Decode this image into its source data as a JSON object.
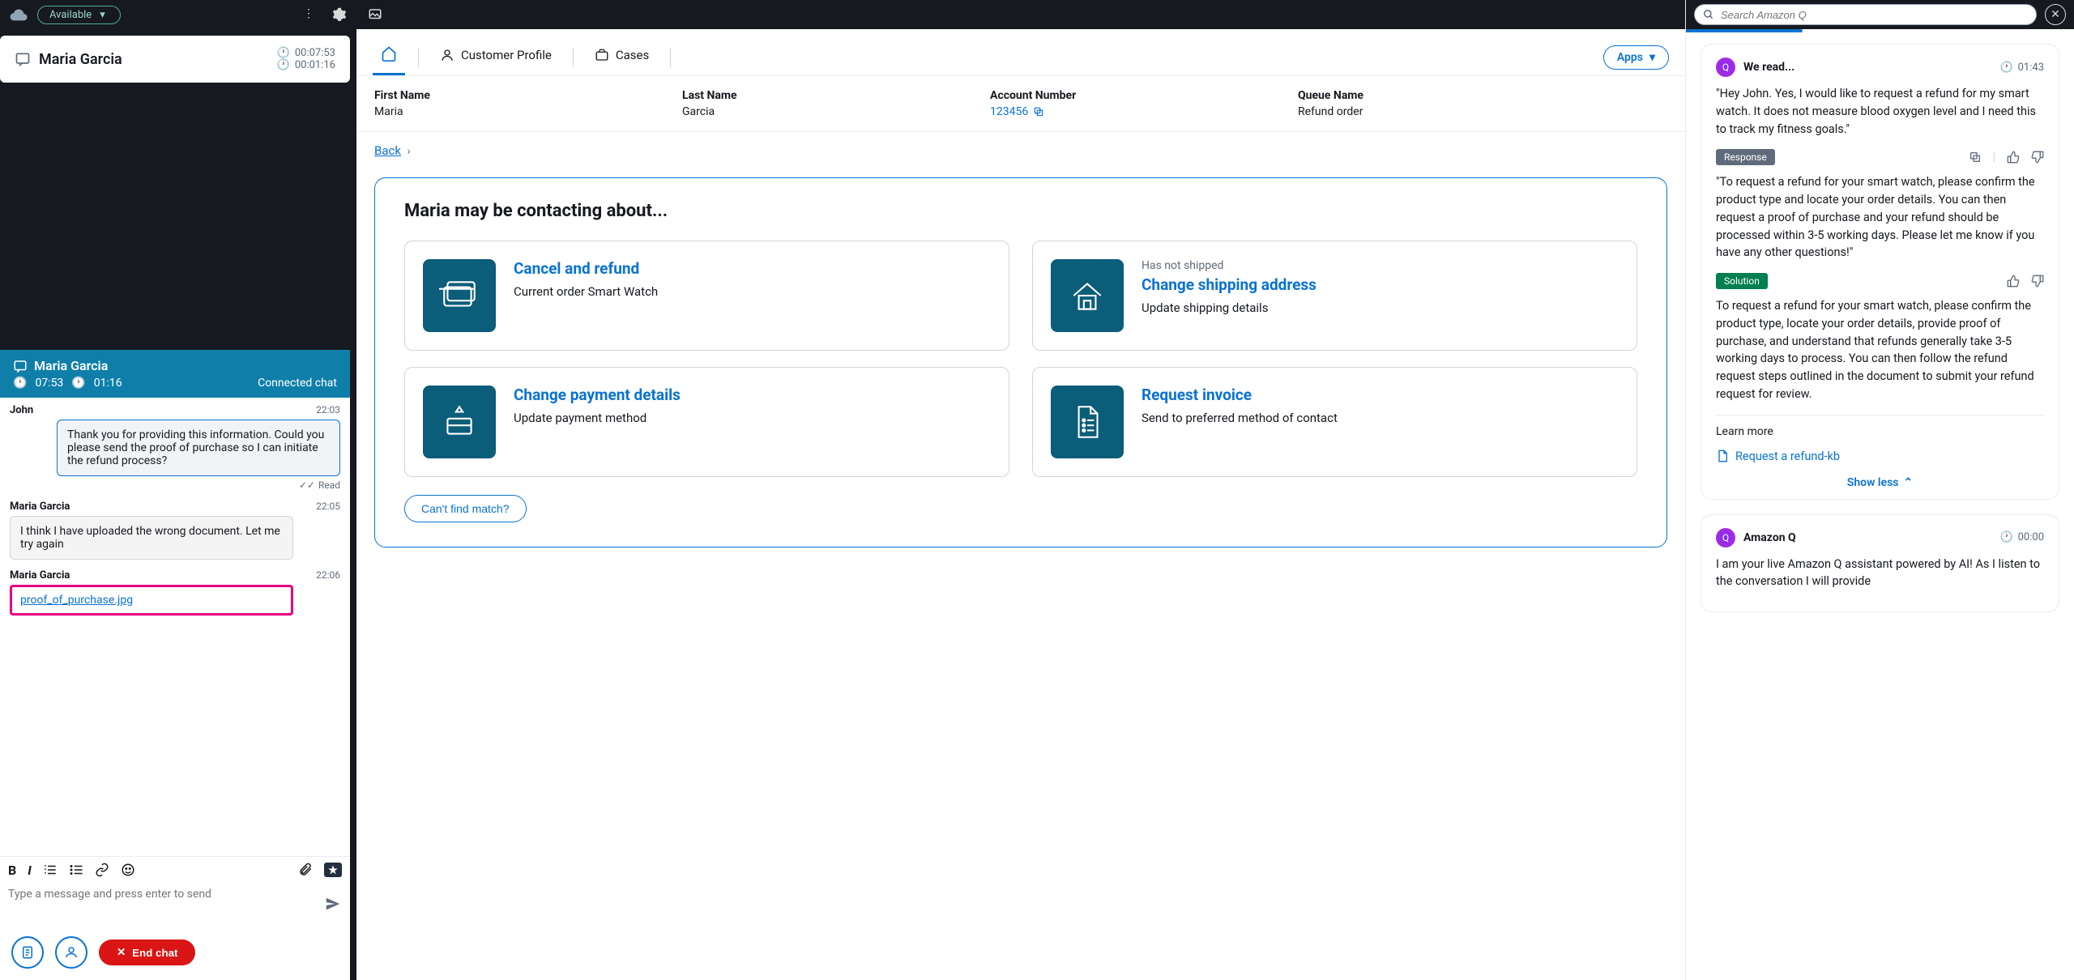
{
  "topbar": {
    "status": "Available",
    "contact_name": "Maria Garcia",
    "timer1": "00:07:53",
    "timer2": "00:01:16"
  },
  "active_contact": {
    "name": "Maria Garcia",
    "t1": "07:53",
    "t2": "01:16",
    "status": "Connected chat"
  },
  "chat": {
    "agent_name": "John",
    "agent_time": "22:03",
    "agent_msg": "Thank you for providing this information. Could you please send the proof of purchase so I can initiate the refund process?",
    "read": "Read",
    "cust1_name": "Maria Garcia",
    "cust1_time": "22:05",
    "cust1_msg": "I think I have uploaded the wrong document. Let me try again",
    "cust2_name": "Maria Garcia",
    "cust2_time": "22:06",
    "attachment": "proof_of_purchase.jpg",
    "placeholder": "Type a message and press enter to send",
    "end_chat": "End chat"
  },
  "nav": {
    "customer_profile": "Customer Profile",
    "cases": "Cases",
    "apps": "Apps"
  },
  "info": {
    "first_lbl": "First Name",
    "first_val": "Maria",
    "last_lbl": "Last Name",
    "last_val": "Garcia",
    "acct_lbl": "Account Number",
    "acct_val": "123456",
    "queue_lbl": "Queue Name",
    "queue_val": "Refund order"
  },
  "breadcrumb": {
    "back": "Back"
  },
  "panel": {
    "heading": "Maria may be contacting about...",
    "cards": [
      {
        "pre": "",
        "title": "Cancel and refund",
        "sub": "Current order Smart Watch"
      },
      {
        "pre": "Has not shipped",
        "title": "Change shipping address",
        "sub": "Update shipping details"
      },
      {
        "pre": "",
        "title": "Change payment details",
        "sub": "Update payment method"
      },
      {
        "pre": "",
        "title": "Request invoice",
        "sub": "Send to preferred method of contact"
      }
    ],
    "cant_find": "Can't find match?"
  },
  "q": {
    "search_placeholder": "Search Amazon Q",
    "card1": {
      "title": "We read...",
      "time": "01:43",
      "quote": "\"Hey John. Yes, I would like to request a refund for my smart watch. It does not measure blood oxygen level and I need this to track my fitness goals.\"",
      "tag_response": "Response",
      "response": "\"To request a refund for your smart watch, please confirm the product type and locate your order details. You can then request a proof of purchase and your refund should be processed within 3-5 working days. Please let me know if you have any other questions!\"",
      "tag_solution": "Solution",
      "solution": "To request a refund for your smart watch, please confirm the product type, locate your order details, provide proof of purchase, and understand that refunds generally take 3-5 working days to process. You can then follow the refund request steps outlined in the document to submit your refund request for review.",
      "learn_more": "Learn more",
      "kb": "Request a refund-kb",
      "show_less": "Show less"
    },
    "card2": {
      "title": "Amazon Q",
      "time": "00:00",
      "text": "I am your live Amazon Q assistant powered by AI! As I listen to the conversation I will provide"
    }
  }
}
